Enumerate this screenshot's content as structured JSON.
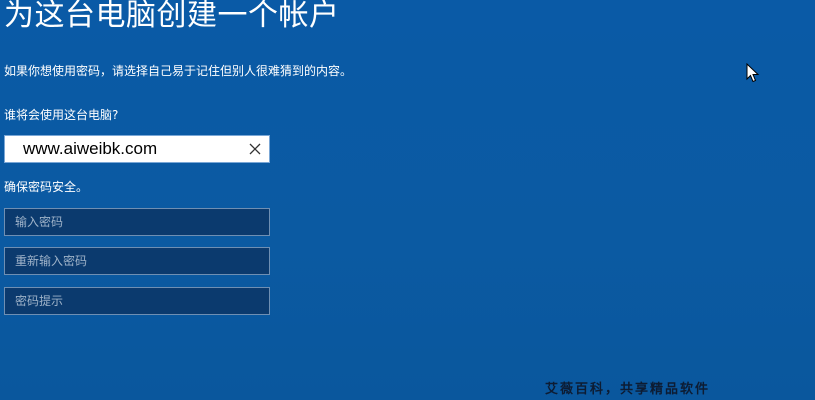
{
  "page": {
    "title": "为这台电脑创建一个帐户",
    "description": "如果你想使用密码，请选择自己易于记住但别人很难猜到的内容。"
  },
  "username": {
    "label": "谁将会使用这台电脑?",
    "value": "www.aiweibk.com"
  },
  "password": {
    "label": "确保密码安全。",
    "fields": [
      {
        "placeholder": "输入密码"
      },
      {
        "placeholder": "重新输入密码"
      },
      {
        "placeholder": "密码提示"
      }
    ]
  },
  "watermark": "艾薇百科，共享精品软件",
  "colors": {
    "background": "#0b5ba3",
    "field_dark": "#0b3a6e",
    "field_border": "#6f8fb3",
    "placeholder": "#9fb3c9"
  },
  "icons": {
    "clear": "close-icon",
    "pointer": "mouse-cursor-icon"
  }
}
